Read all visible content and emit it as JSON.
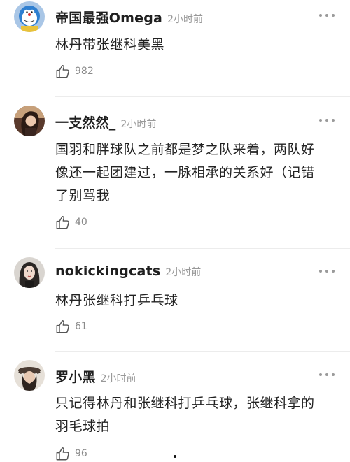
{
  "comments": [
    {
      "username": "帝国最强Omega",
      "time": "2小时前",
      "lines": [
        "林丹带张继科美黑"
      ],
      "likes": "982"
    },
    {
      "username": "一支然然_",
      "time": "2小时前",
      "lines": [
        "国羽和胖球队之前都是梦之队来着，两队好",
        "像还一起团建过，一脉相承的关系好（记错",
        "了别骂我"
      ],
      "likes": "40"
    },
    {
      "username": "nokickingcats",
      "time": "2小时前",
      "lines": [
        "林丹张继科打乒乓球"
      ],
      "likes": "61"
    },
    {
      "username": "罗小黑",
      "time": "2小时前",
      "lines": [
        "只记得林丹和张继科打乒乓球，张继科拿的",
        "羽毛球拍"
      ],
      "likes": "96"
    }
  ],
  "icons": {
    "like": "thumbs-up-icon",
    "more": "more-dots-icon"
  }
}
